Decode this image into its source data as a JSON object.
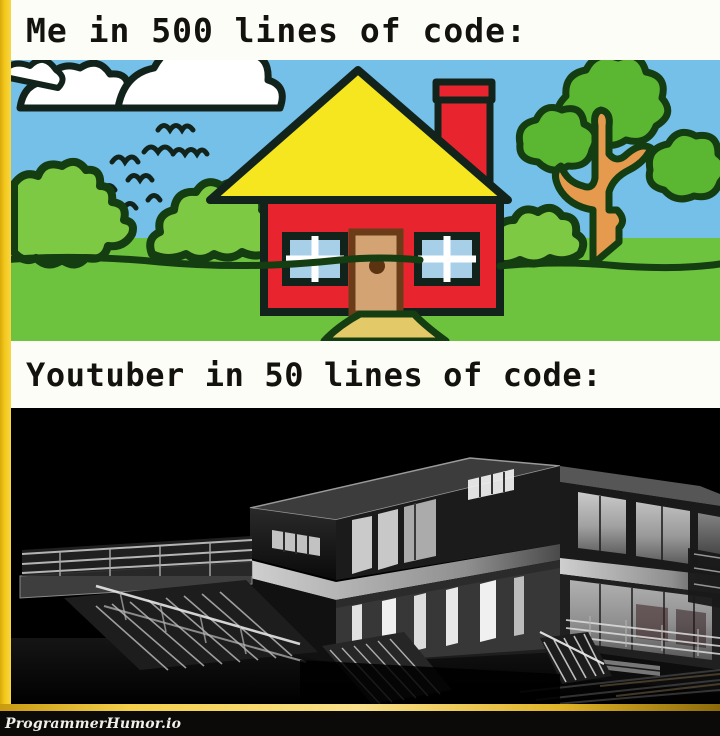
{
  "meme": {
    "panels": [
      {
        "caption": "Me in 500 lines of code:",
        "artwork": "childs-crayon-drawing-of-house",
        "alt": "Childlike crayon drawing: red house with yellow triangular roof, red chimney, tan door, two blue windows, green bushes, green grass, a tree with orange trunk, blue sky with white clouds and birds"
      },
      {
        "caption": "Youtuber in 50 lines of code:",
        "artwork": "modern-villa-night-render",
        "alt": "Black and white architectural render of a modern two-story glass villa lit up at night with exterior staircases, terraces and railings"
      }
    ],
    "watermark": "ProgrammerHumor.io",
    "colors": {
      "border_gold": "#f4c91b",
      "caption_background": "#fdfdf7",
      "caption_text": "#14120f",
      "sky_blue": "#74c0e8",
      "grass_green": "#6dc33e",
      "bush_green": "#7ec943",
      "bush_outline": "#143d12",
      "house_red": "#e8252f",
      "roof_yellow": "#f6e61f",
      "door_tan": "#d3a374",
      "window_blue": "#a8cfe8",
      "trunk_orange": "#e59a4e",
      "outline_black": "#0d1a12",
      "render_background": "#000000",
      "render_light": "#f2f2f2"
    }
  }
}
